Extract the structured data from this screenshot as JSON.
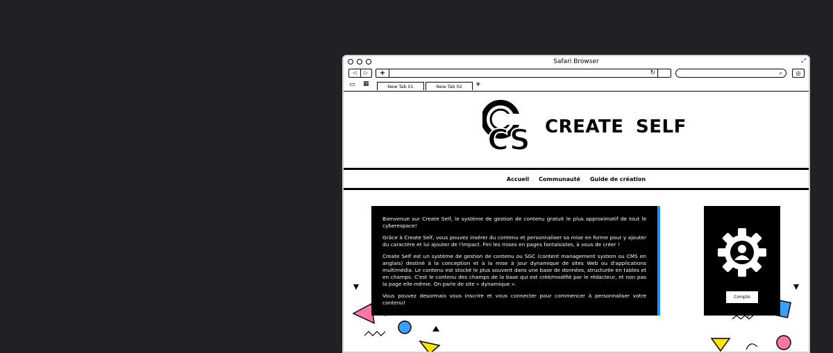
{
  "window": {
    "title": "Safari Browser"
  },
  "toolbar": {
    "back": "◁",
    "forward": "▷",
    "new_tab": "+",
    "reload": "↻",
    "search_icon": "search-icon",
    "profile": "◎"
  },
  "tabs": [
    {
      "label": "New Tab 01"
    },
    {
      "label": "New Tab 02"
    }
  ],
  "tab_add": "+",
  "site": {
    "brand": "CREATE SELF",
    "logo_text": "CS",
    "nav": [
      "Accueil",
      "Communauté",
      "Guide de création"
    ],
    "intro": [
      "Bienvenue sur Create Self, le système de gestion de contenu gratuit le plus approximatif de tout le cyberespace!",
      "Grâce à Create Self, vous pouvez insérer du contenu et personnaliser sa mise en forme pour y ajouter du caractère et lui ajouter de l'impact. Fini les mises en pages fantaisistes, à vous de créer !",
      "Create Self est un système de gestion de contenu ou SGC (content management system ou CMS en anglais) destiné à la conception et à la mise à jour dynamique de sites Web ou d'applications multimédia. Le contenu est stocké le plus souvent dans une base de données, structurée en tables et en champs. C'est le contenu des champs de la base qui est créé/modifié par le rédacteur, et non pas la page elle-même. On parle de site « dynamique ».",
      "Vous pouvez desormais vous inscrire et vous connecter pour commencer à personnaliser votre contenu!"
    ],
    "account_button": "Compte",
    "accent_color": "#1e90ff"
  }
}
